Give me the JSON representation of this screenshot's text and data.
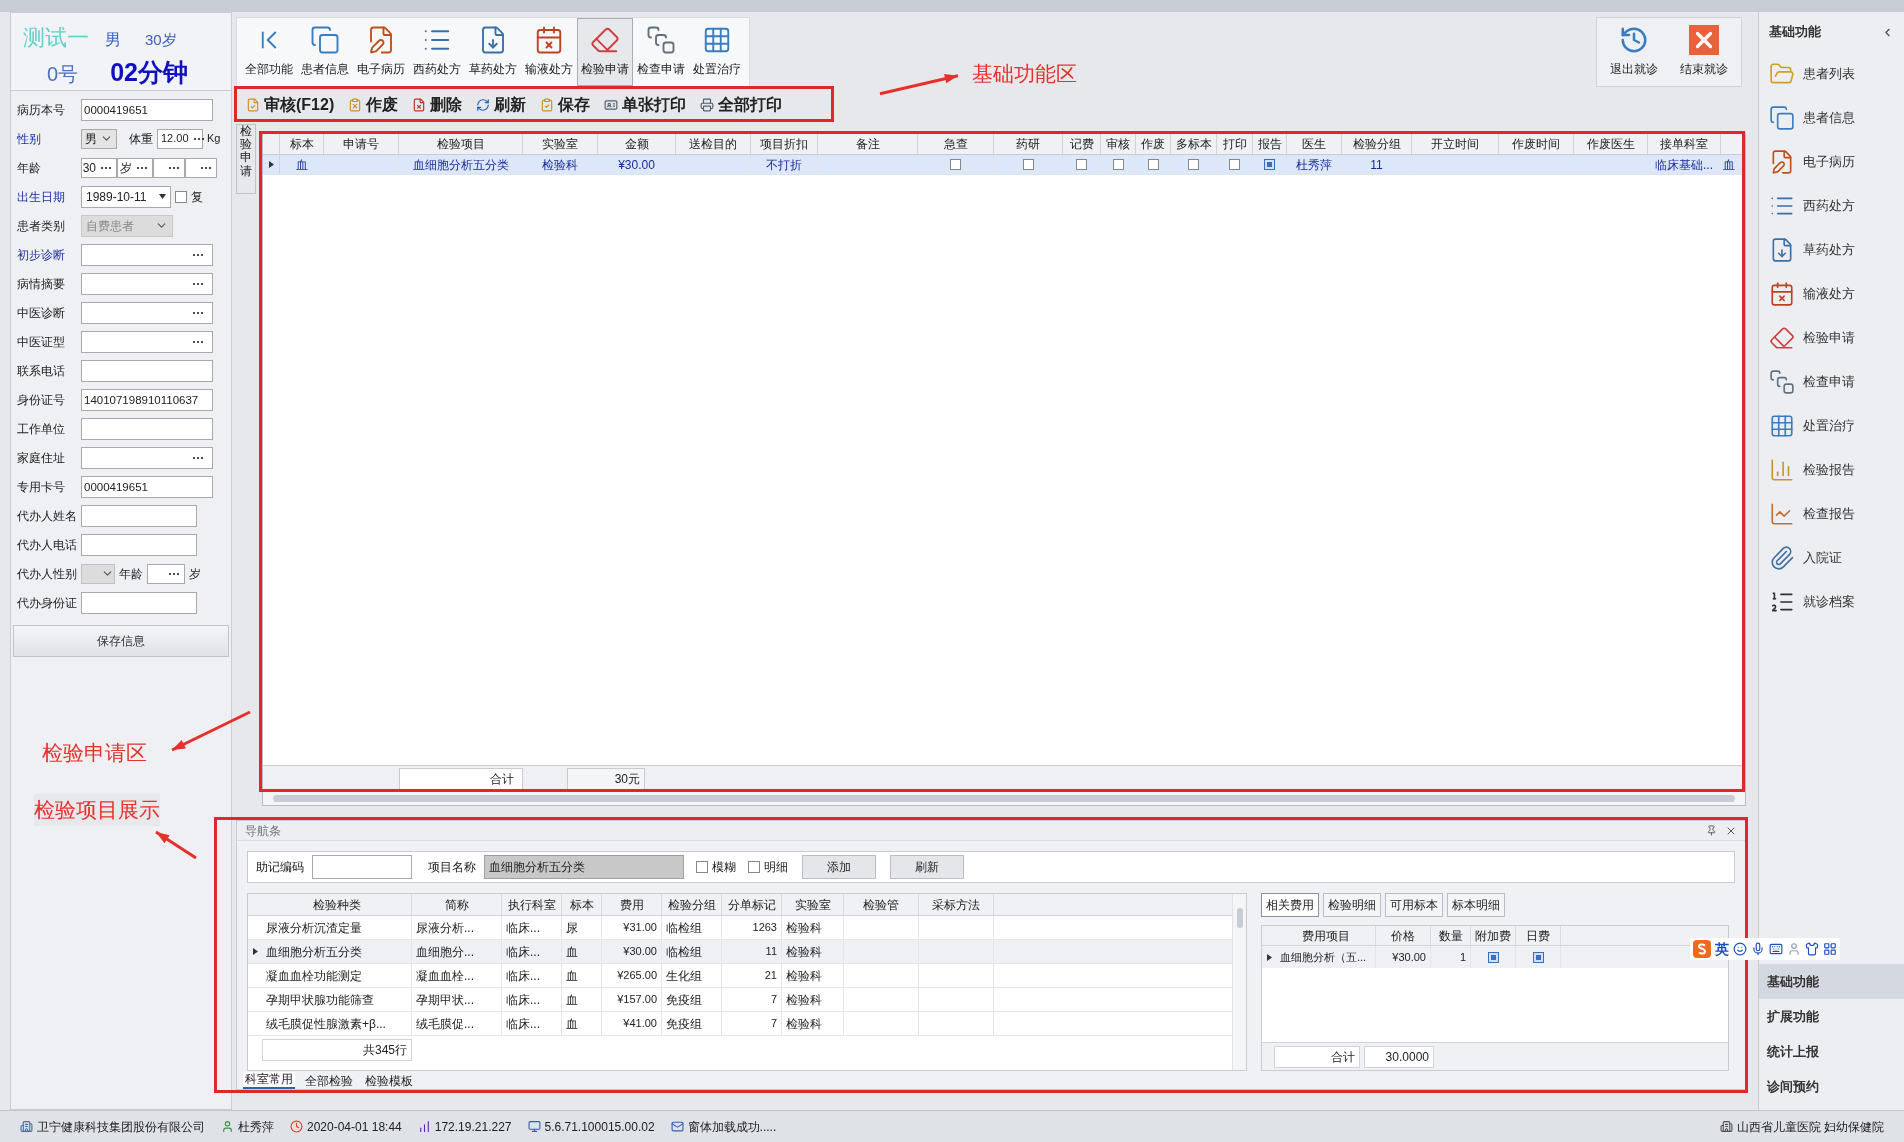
{
  "patient": {
    "name": "测试一",
    "sex": "男",
    "age": "30岁",
    "number": "0号",
    "wait": "02分钟"
  },
  "form": [
    {
      "kind": "text",
      "label": "病历本号",
      "highlighted": false,
      "value": "0000419651"
    },
    {
      "kind": "sex_weight",
      "label": "性别",
      "highlighted": true,
      "sex": "男",
      "weight_label": "体重",
      "weight": "12.00",
      "unit": "Kg"
    },
    {
      "kind": "age",
      "label": "年龄",
      "highlighted": false,
      "age": "30",
      "age_unit": "岁"
    },
    {
      "kind": "date",
      "label": "出生日期",
      "highlighted": true,
      "value": "1989-10-11",
      "check_label": "复",
      "checked": false
    },
    {
      "kind": "select",
      "label": "患者类别",
      "highlighted": false,
      "value": "自费患者",
      "disabled": true
    },
    {
      "kind": "lookup",
      "label": "初步诊断",
      "highlighted": true
    },
    {
      "kind": "lookup",
      "label": "病情摘要",
      "highlighted": false
    },
    {
      "kind": "lookup",
      "label": "中医诊断",
      "highlighted": false
    },
    {
      "kind": "lookup",
      "label": "中医证型",
      "highlighted": false
    },
    {
      "kind": "text",
      "label": "联系电话",
      "highlighted": false
    },
    {
      "kind": "text",
      "label": "身份证号",
      "highlighted": false,
      "value": "140107198910110637"
    },
    {
      "kind": "text",
      "label": "工作单位",
      "highlighted": false
    },
    {
      "kind": "lookup",
      "label": "家庭住址",
      "highlighted": false
    },
    {
      "kind": "text",
      "label": "专用卡号",
      "highlighted": false,
      "value": "0000419651"
    },
    {
      "kind": "text",
      "label": "代办人姓名",
      "highlighted": false
    },
    {
      "kind": "text",
      "label": "代办人电话",
      "highlighted": false
    },
    {
      "kind": "agent_sex",
      "label": "代办人性别",
      "highlighted": false,
      "age_label": "年龄",
      "age_unit": "岁"
    },
    {
      "kind": "text",
      "label": "代办身份证",
      "highlighted": false
    }
  ],
  "save_button": "保存信息",
  "toolbar": {
    "items": [
      {
        "label": "全部功能",
        "selected": false
      },
      {
        "label": "患者信息",
        "selected": false
      },
      {
        "label": "电子病历",
        "selected": false
      },
      {
        "label": "西药处方",
        "selected": false
      },
      {
        "label": "草药处方",
        "selected": false
      },
      {
        "label": "输液处方",
        "selected": false
      },
      {
        "label": "检验申请",
        "selected": true
      },
      {
        "label": "检查申请",
        "selected": false
      },
      {
        "label": "处置治疗",
        "selected": false
      }
    ],
    "visit_actions": [
      "退出就诊",
      "结束就诊"
    ]
  },
  "actions": [
    "审核(F12)",
    "作废",
    "删除",
    "刷新",
    "保存",
    "单张打印",
    "全部打印"
  ],
  "request_grid": {
    "side_tab": "检验申请",
    "columns": [
      "标本",
      "申请号",
      "检验项目",
      "实验室",
      "金额",
      "送检目的",
      "项目折扣",
      "备注",
      "急查",
      "药研",
      "记费",
      "审核",
      "作废",
      "多标本",
      "打印",
      "报告",
      "医生",
      "检验分组",
      "开立时间",
      "作废时间",
      "作废医生",
      "接单科室"
    ],
    "rows": [
      {
        "selected": true,
        "cells": [
          {
            "kind": "text",
            "text": "血"
          },
          {
            "kind": "text"
          },
          {
            "kind": "text",
            "text": "血细胞分析五分类"
          },
          {
            "kind": "text",
            "text": "检验科"
          },
          {
            "kind": "text",
            "text": "¥30.00"
          },
          {
            "kind": "text"
          },
          {
            "kind": "text",
            "text": "不打折"
          },
          {
            "kind": "text"
          },
          {
            "kind": "check",
            "checked": false
          },
          {
            "kind": "check",
            "checked": false
          },
          {
            "kind": "check",
            "checked": false
          },
          {
            "kind": "check",
            "checked": false
          },
          {
            "kind": "check",
            "checked": false
          },
          {
            "kind": "check",
            "checked": false
          },
          {
            "kind": "check",
            "checked": false
          },
          {
            "kind": "icon"
          },
          {
            "kind": "text",
            "text": "杜秀萍"
          },
          {
            "kind": "text",
            "text": "11"
          },
          {
            "kind": "text"
          },
          {
            "kind": "text"
          },
          {
            "kind": "text"
          },
          {
            "kind": "text",
            "text": "临床基础..."
          },
          {
            "kind": "text",
            "text": "血"
          }
        ]
      }
    ],
    "total_label": "合计",
    "total": "30元"
  },
  "nav_panel": {
    "title": "导航条",
    "search": {
      "code_label": "助记编码",
      "name_label": "项目名称",
      "name_value": "血细胞分析五分类",
      "options": [
        {
          "label": "模糊",
          "checked": false
        },
        {
          "label": "明细",
          "checked": false
        }
      ],
      "buttons": [
        "添加",
        "刷新"
      ]
    },
    "items": {
      "columns": [
        "检验种类",
        "简称",
        "执行科室",
        "标本",
        "费用",
        "检验分组",
        "分单标记",
        "实验室",
        "检验管",
        "采标方法"
      ],
      "rows": [
        {
          "selected": false,
          "cells": [
            "尿液分析沉渣定量",
            "尿液分析...",
            "临床...",
            "尿",
            "¥31.00",
            "临检组",
            "1263",
            "检验科"
          ]
        },
        {
          "selected": true,
          "cells": [
            "血细胞分析五分类",
            "血细胞分...",
            "临床...",
            "血",
            "¥30.00",
            "临检组",
            "11",
            "检验科"
          ]
        },
        {
          "selected": false,
          "cells": [
            "凝血血栓功能测定",
            "凝血血栓...",
            "临床...",
            "血",
            "¥265.00",
            "生化组",
            "21",
            "检验科"
          ]
        },
        {
          "selected": false,
          "cells": [
            "孕期甲状腺功能筛查",
            "孕期甲状...",
            "临床...",
            "血",
            "¥157.00",
            "免疫组",
            "7",
            "检验科"
          ]
        },
        {
          "selected": false,
          "cells": [
            "绒毛膜促性腺激素+β...",
            "绒毛膜促...",
            "临床...",
            "血",
            "¥41.00",
            "免疫组",
            "7",
            "检验科"
          ]
        }
      ],
      "count": "共345行"
    },
    "tabs": [
      {
        "label": "科室常用",
        "selected": true
      },
      {
        "label": "全部检验",
        "selected": false
      },
      {
        "label": "检验模板",
        "selected": false
      }
    ],
    "detail": {
      "tabs": [
        {
          "label": "相关费用",
          "selected": true
        },
        {
          "label": "检验明细",
          "selected": false
        },
        {
          "label": "可用标本",
          "selected": false
        },
        {
          "label": "标本明细",
          "selected": false
        }
      ],
      "columns": [
        "费用项目",
        "价格",
        "数量",
        "附加费",
        "日费"
      ],
      "rows": [
        {
          "selected": true,
          "cells": [
            {
              "kind": "text",
              "text": "血细胞分析（五..."
            },
            {
              "kind": "text",
              "text": "¥30.00"
            },
            {
              "kind": "text",
              "text": "1"
            },
            {
              "kind": "icon"
            },
            {
              "kind": "icon"
            }
          ]
        }
      ],
      "total_label": "合计",
      "total": "30.0000"
    }
  },
  "sidebar": {
    "title": "基础功能",
    "items": [
      "患者列表",
      "患者信息",
      "电子病历",
      "西药处方",
      "草药处方",
      "输液处方",
      "检验申请",
      "检查申请",
      "处置治疗",
      "检验报告",
      "检查报告",
      "入院证",
      "就诊档案"
    ],
    "groups": [
      {
        "label": "基础功能",
        "selected": true
      },
      {
        "label": "扩展功能",
        "selected": false
      },
      {
        "label": "统计上报",
        "selected": false
      },
      {
        "label": "诊间预约",
        "selected": false
      }
    ]
  },
  "ime": {
    "mode": "英"
  },
  "status_bar": [
    "卫宁健康科技集团股份有限公司",
    "杜秀萍",
    "2020-04-01 18:44",
    "172.19.21.227",
    "5.6.71.100015.00.02",
    "窗体加载成功.....",
    "山西省儿童医院 妇幼保健院"
  ],
  "annotations": [
    {
      "label": "基础功能区"
    },
    {
      "label": "检验申请区"
    },
    {
      "label": "检验项目展示"
    }
  ]
}
